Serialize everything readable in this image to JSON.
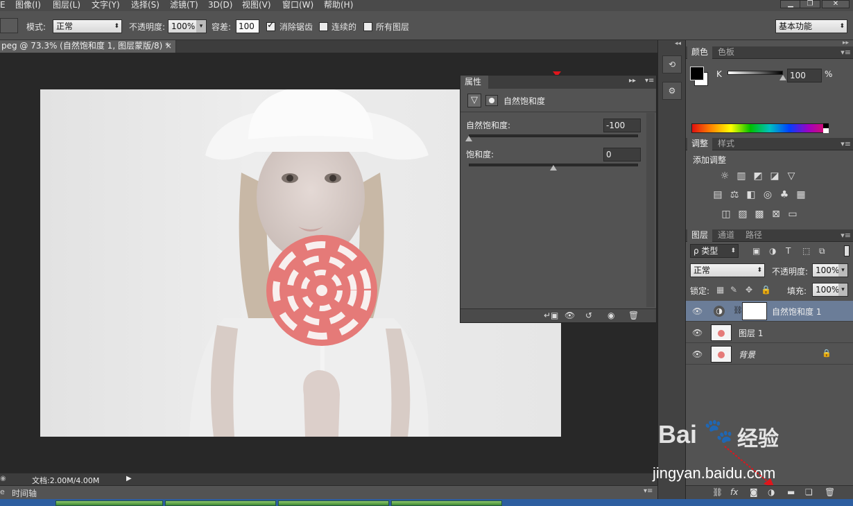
{
  "menu": [
    "图像(I)",
    "图层(L)",
    "文字(Y)",
    "选择(S)",
    "滤镜(T)",
    "3D(D)",
    "视图(V)",
    "窗口(W)",
    "帮助(H)"
  ],
  "menu_partial": "E",
  "options": {
    "mode_label": "模式:",
    "mode_value": "正常",
    "opacity_label": "不透明度:",
    "opacity_value": "100%",
    "tolerance_label": "容差:",
    "tolerance_value": "100",
    "antialias_label": "消除锯齿",
    "contiguous_label": "连续的",
    "all_layers_label": "所有图层",
    "workspace_value": "基本功能"
  },
  "doc_tab": {
    "title": "peg @ 73.3% (自然饱和度 1, 图层蒙版/8) *",
    "close": "×"
  },
  "status": {
    "doc_info": "文档:2.00M/4.00M",
    "timeline_label": "时间轴"
  },
  "properties": {
    "tab": "属性",
    "adjust_name": "自然饱和度",
    "vibrance_label": "自然饱和度:",
    "vibrance_value": "-100",
    "vibrance_level": 0,
    "saturation_label": "饱和度:",
    "saturation_value": "0",
    "saturation_level": 0.5
  },
  "color_panel": {
    "tabs": [
      "颜色",
      "色板"
    ],
    "channel_label": "K",
    "channel_value": "100",
    "unit": "%"
  },
  "adjust_panel": {
    "tabs": [
      "调整",
      "样式"
    ],
    "title": "添加调整"
  },
  "layers_panel": {
    "tabs": [
      "图层",
      "通道",
      "路径"
    ],
    "filter_value": "ρ 类型",
    "blend_value": "正常",
    "opacity_label": "不透明度:",
    "opacity_value": "100%",
    "lock_label": "锁定:",
    "fill_label": "填充:",
    "fill_value": "100%",
    "layers": [
      "自然饱和度 1",
      "图层 1",
      "背景"
    ]
  },
  "watermark": {
    "brand": "Bai",
    "brand_cn": "经验",
    "url": "jingyan.baidu.com"
  },
  "colors": {
    "accent_arrow": "#e0151b",
    "selected_layer": "#6b7d98"
  }
}
